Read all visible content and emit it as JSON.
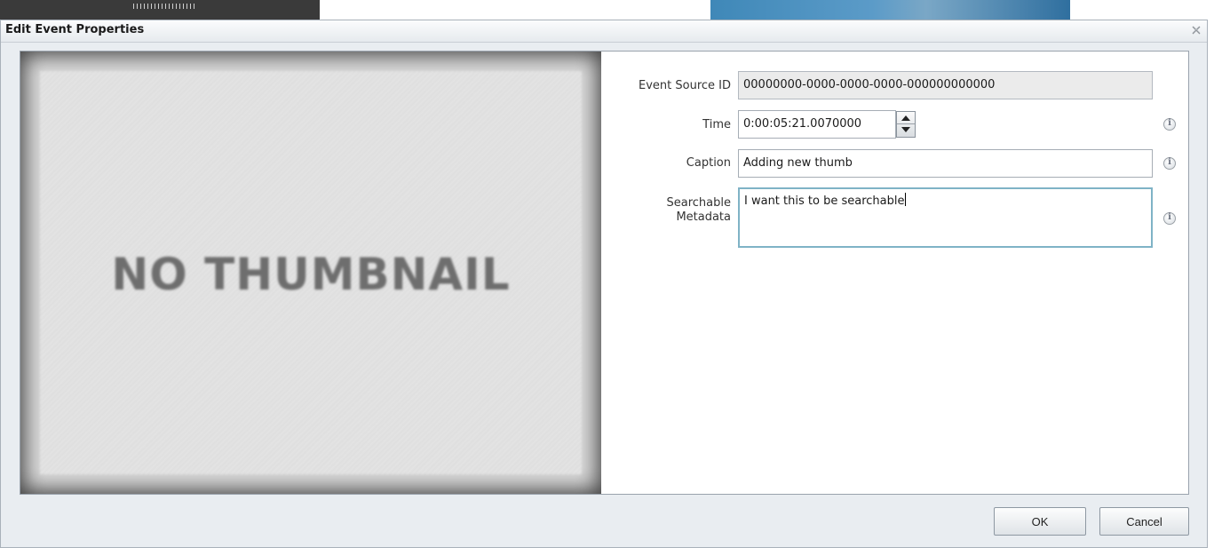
{
  "dialog": {
    "title": "Edit Event Properties"
  },
  "thumbnail": {
    "text": "NO THUMBNAIL"
  },
  "form": {
    "event_source_id": {
      "label": "Event Source ID",
      "value": "00000000-0000-0000-0000-000000000000"
    },
    "time": {
      "label": "Time",
      "value": "0:00:05:21.0070000"
    },
    "caption": {
      "label": "Caption",
      "value": "Adding new thumb"
    },
    "searchable_metadata": {
      "label_line1": "Searchable",
      "label_line2": "Metadata",
      "value": "I want this to be searchable"
    }
  },
  "footer": {
    "ok_label": "OK",
    "cancel_label": "Cancel"
  },
  "icons": {
    "info": "i"
  }
}
